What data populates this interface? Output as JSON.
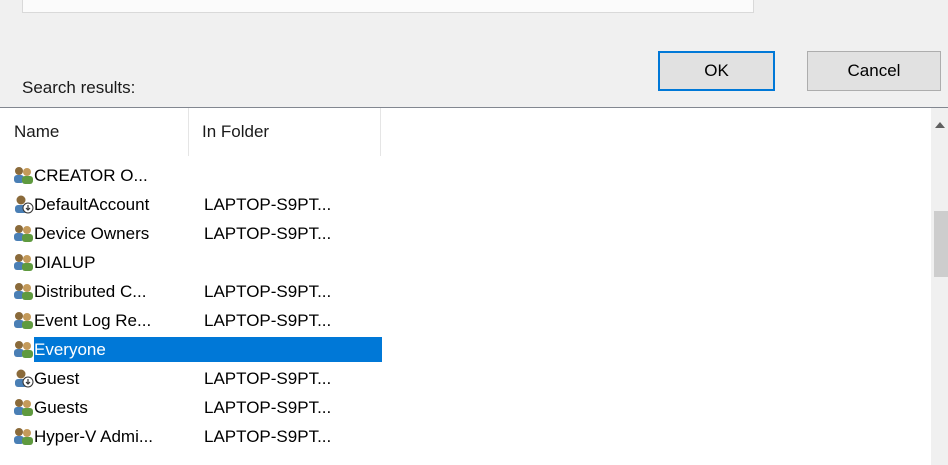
{
  "search_label": "Search results:",
  "buttons": {
    "ok": "OK",
    "cancel": "Cancel"
  },
  "columns": {
    "name": "Name",
    "folder": "In Folder"
  },
  "rows": [
    {
      "name": "CREATOR O...",
      "folder": "",
      "icon": "group-icon",
      "selected": false
    },
    {
      "name": "DefaultAccount",
      "folder": "LAPTOP-S9PT...",
      "icon": "user-icon",
      "selected": false
    },
    {
      "name": "Device Owners",
      "folder": "LAPTOP-S9PT...",
      "icon": "group-icon",
      "selected": false
    },
    {
      "name": "DIALUP",
      "folder": "",
      "icon": "group-icon",
      "selected": false
    },
    {
      "name": "Distributed C...",
      "folder": "LAPTOP-S9PT...",
      "icon": "group-icon",
      "selected": false
    },
    {
      "name": "Event Log Re...",
      "folder": "LAPTOP-S9PT...",
      "icon": "group-icon",
      "selected": false
    },
    {
      "name": "Everyone",
      "folder": "",
      "icon": "group-icon",
      "selected": true
    },
    {
      "name": "Guest",
      "folder": "LAPTOP-S9PT...",
      "icon": "user-icon",
      "selected": false
    },
    {
      "name": "Guests",
      "folder": "LAPTOP-S9PT...",
      "icon": "group-icon",
      "selected": false
    },
    {
      "name": "Hyper-V Admi...",
      "folder": "LAPTOP-S9PT...",
      "icon": "group-icon",
      "selected": false
    }
  ],
  "colors": {
    "selection": "#0078d7",
    "default_button_border": "#0078d7"
  }
}
